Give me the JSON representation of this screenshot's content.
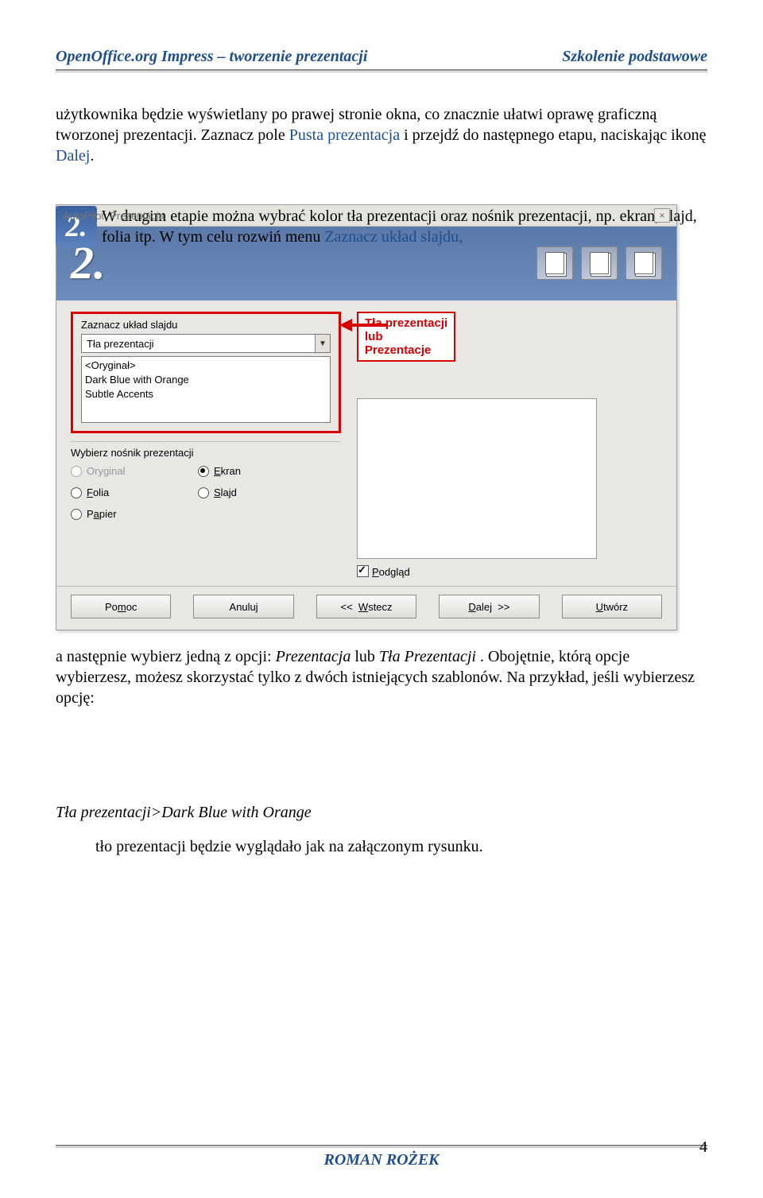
{
  "header": {
    "left": "OpenOffice.org Impress – tworzenie prezentacji",
    "right": "Szkolenie podstawowe"
  },
  "para1": {
    "a": "użytkownika będzie wyświetlany po prawej stronie okna, co znacznie ułatwi oprawę graficzną tworzonej prezentacji. Zaznacz pole ",
    "link1": "Pusta prezentacja",
    "b": " i przejdź do następnego etapu, naciskając ikonę ",
    "link2": "Dalej",
    "c": "."
  },
  "step2": {
    "number": "2.",
    "a": "W drugim etapie można wybrać kolor tła prezentacji oraz nośnik prezentacji, np. ekran, slajd, folia itp. W tym celu rozwiń menu ",
    "link": "Zaznacz układ slajdu,"
  },
  "dialog": {
    "title": "AutoPilot: Prezentacja",
    "bignum": "2.",
    "group_label": "Zaznacz układ slajdu",
    "combo_value": "Tła prezentacji",
    "list": [
      "<Oryginał>",
      "Dark Blue with Orange",
      "Subtle Accents"
    ],
    "annotation": {
      "l1": "Tła prezentacji",
      "l2": "lub",
      "l3": "Prezentacje"
    },
    "medium_label": "Wybierz nośnik prezentacji",
    "radios": {
      "oryginal": "Oryginał",
      "ekran": "Ekran",
      "folia": "Folia",
      "slajd": "Slajd",
      "papier": "Papier"
    },
    "podglad": "Podgląd",
    "buttons": {
      "pomoc": "Pomoc",
      "anuluj": "Anuluj",
      "wstecz": "<<  Wstecz",
      "dalej": "Dalej  >>",
      "utworz": "Utwórz"
    }
  },
  "para2": {
    "a": " a następnie wybierz jedną z opcji: ",
    "i1": "Prezentacja",
    "b": " lub ",
    "i2": "Tła Prezentacji ",
    "c": ". Obojętnie, którą opcje wybierzesz, możesz skorzystać tylko z dwóch istniejących szablonów. Na przykład, jeśli wybierzesz opcję:"
  },
  "example_line": "Tła prezentacji>Dark Blue with Orange",
  "example_after": "tło prezentacji będzie wyglądało jak na załączonym rysunku.",
  "footer": {
    "author": "ROMAN ROŻEK",
    "page": "4"
  }
}
